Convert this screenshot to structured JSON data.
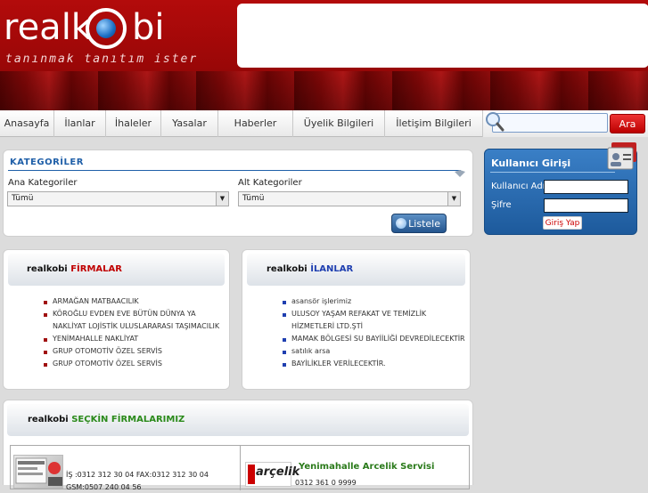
{
  "header": {
    "logo_left": "realk",
    "logo_right": "bi",
    "slogan": "tanınmak tanıtım ister"
  },
  "nav": {
    "items": [
      "Anasayfa",
      "İlanlar",
      "İhaleler",
      "Yasalar",
      "Haberler",
      "Üyelik Bilgileri",
      "İletişim Bilgileri"
    ]
  },
  "search": {
    "placeholder": "",
    "button_label": "Ara"
  },
  "kategoriler": {
    "title": "KATEGORİLER",
    "ana_label": "Ana Kategoriler",
    "ana_value": "Tümü",
    "alt_label": "Alt Kategoriler",
    "alt_value": "Tümü",
    "listele_label": "Listele"
  },
  "login": {
    "title": "Kullanıcı Girişi",
    "username_label": "Kullanıcı Adı",
    "password_label": "Şifre",
    "button_label": "Giriş Yap"
  },
  "firmalar": {
    "title_prefix": "realkobi ",
    "title_highlight": "FİRMALAR",
    "items": [
      "ARMAĞAN MATBAACILIK",
      "KÖROĞLU EVDEN EVE BÜTÜN DÜNYA YA",
      "NAKLİYAT LOJİSTİK ULUSLARARASI TAŞIMACILIK",
      "YENİMAHALLE NAKLİYAT",
      "GRUP OTOMOTİV ÖZEL SERVİS",
      "GRUP OTOMOTİV ÖZEL SERVİS"
    ]
  },
  "ilanlar": {
    "title_prefix": "realkobi ",
    "title_highlight": "İLANLAR",
    "items": [
      "asansör işlerimiz",
      "ULUSOY YAŞAM REFAKAT VE TEMİZLİK",
      "HİZMETLERİ LTD.ŞTİ",
      "MAMAK BÖLGESİ SU BAYİİLİĞİ DEVREDİLECEKTİR",
      "satılık arsa",
      "BAYİLİKLER VERİLECEKTİR."
    ]
  },
  "secgin": {
    "title_prefix": "realkobi ",
    "title_highlight": "SEÇKİN FİRMALARIMIZ",
    "firm1_phone": "İŞ :0312 312 30 04 FAX:0312 312 30 04",
    "firm1_gsm": "GSM:0507 240 04 56",
    "firm2_name": "Yenimahalle Arcelik Servisi",
    "firm2_phone": "0312 361 0 9999",
    "firm2_logo": "arçelik"
  },
  "colors": {
    "brand_red": "#a80808",
    "accent_blue": "#1f5fa8",
    "firmalar_highlight": "#c00000",
    "ilanlar_highlight": "#1f3fb0",
    "secgin_highlight": "#2a8a1a"
  }
}
